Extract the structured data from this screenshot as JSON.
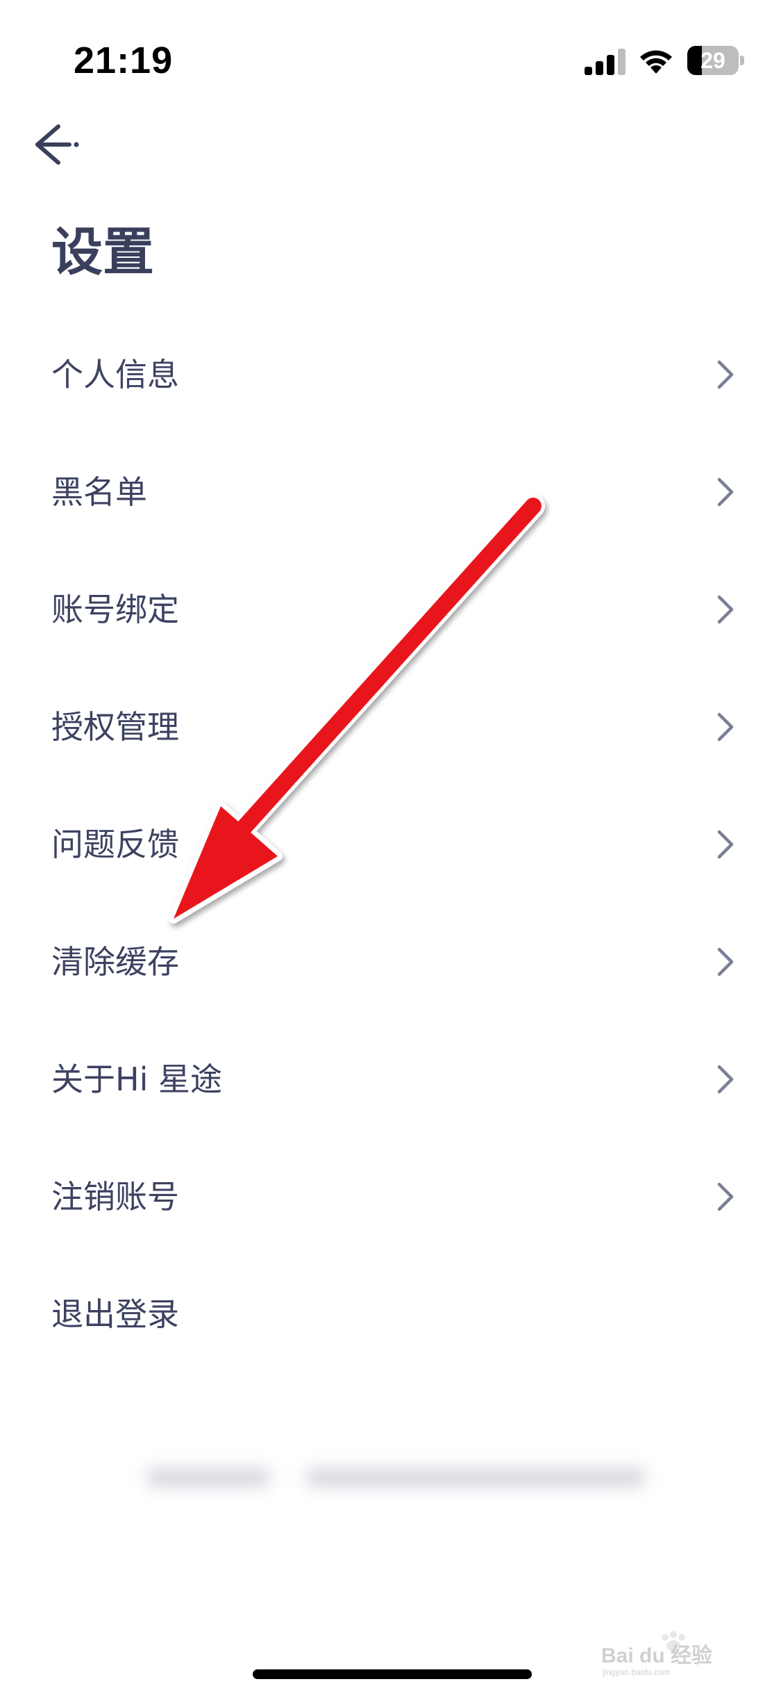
{
  "status_bar": {
    "time": "21:19",
    "battery_level": "29",
    "battery_fraction": 0.29
  },
  "header": {
    "back_icon": "arrow-left-icon",
    "title": "设置"
  },
  "menu": {
    "items": [
      {
        "label": "个人信息",
        "has_chevron": true
      },
      {
        "label": "黑名单",
        "has_chevron": true
      },
      {
        "label": "账号绑定",
        "has_chevron": true
      },
      {
        "label": "授权管理",
        "has_chevron": true
      },
      {
        "label": "问题反馈",
        "has_chevron": true
      },
      {
        "label": "清除缓存",
        "has_chevron": true
      },
      {
        "label": "关于Hi 星途",
        "has_chevron": true
      },
      {
        "label": "注销账号",
        "has_chevron": true
      },
      {
        "label": "退出登录",
        "has_chevron": false
      }
    ]
  },
  "annotation": {
    "arrow_color": "#e8141c",
    "points_to": "清除缓存"
  },
  "watermark": {
    "text": "Bai du 经验",
    "subtext": "jingyan.baidu.com"
  },
  "colors": {
    "text_primary": "#3a3f5c",
    "chevron": "#7a7f95"
  }
}
